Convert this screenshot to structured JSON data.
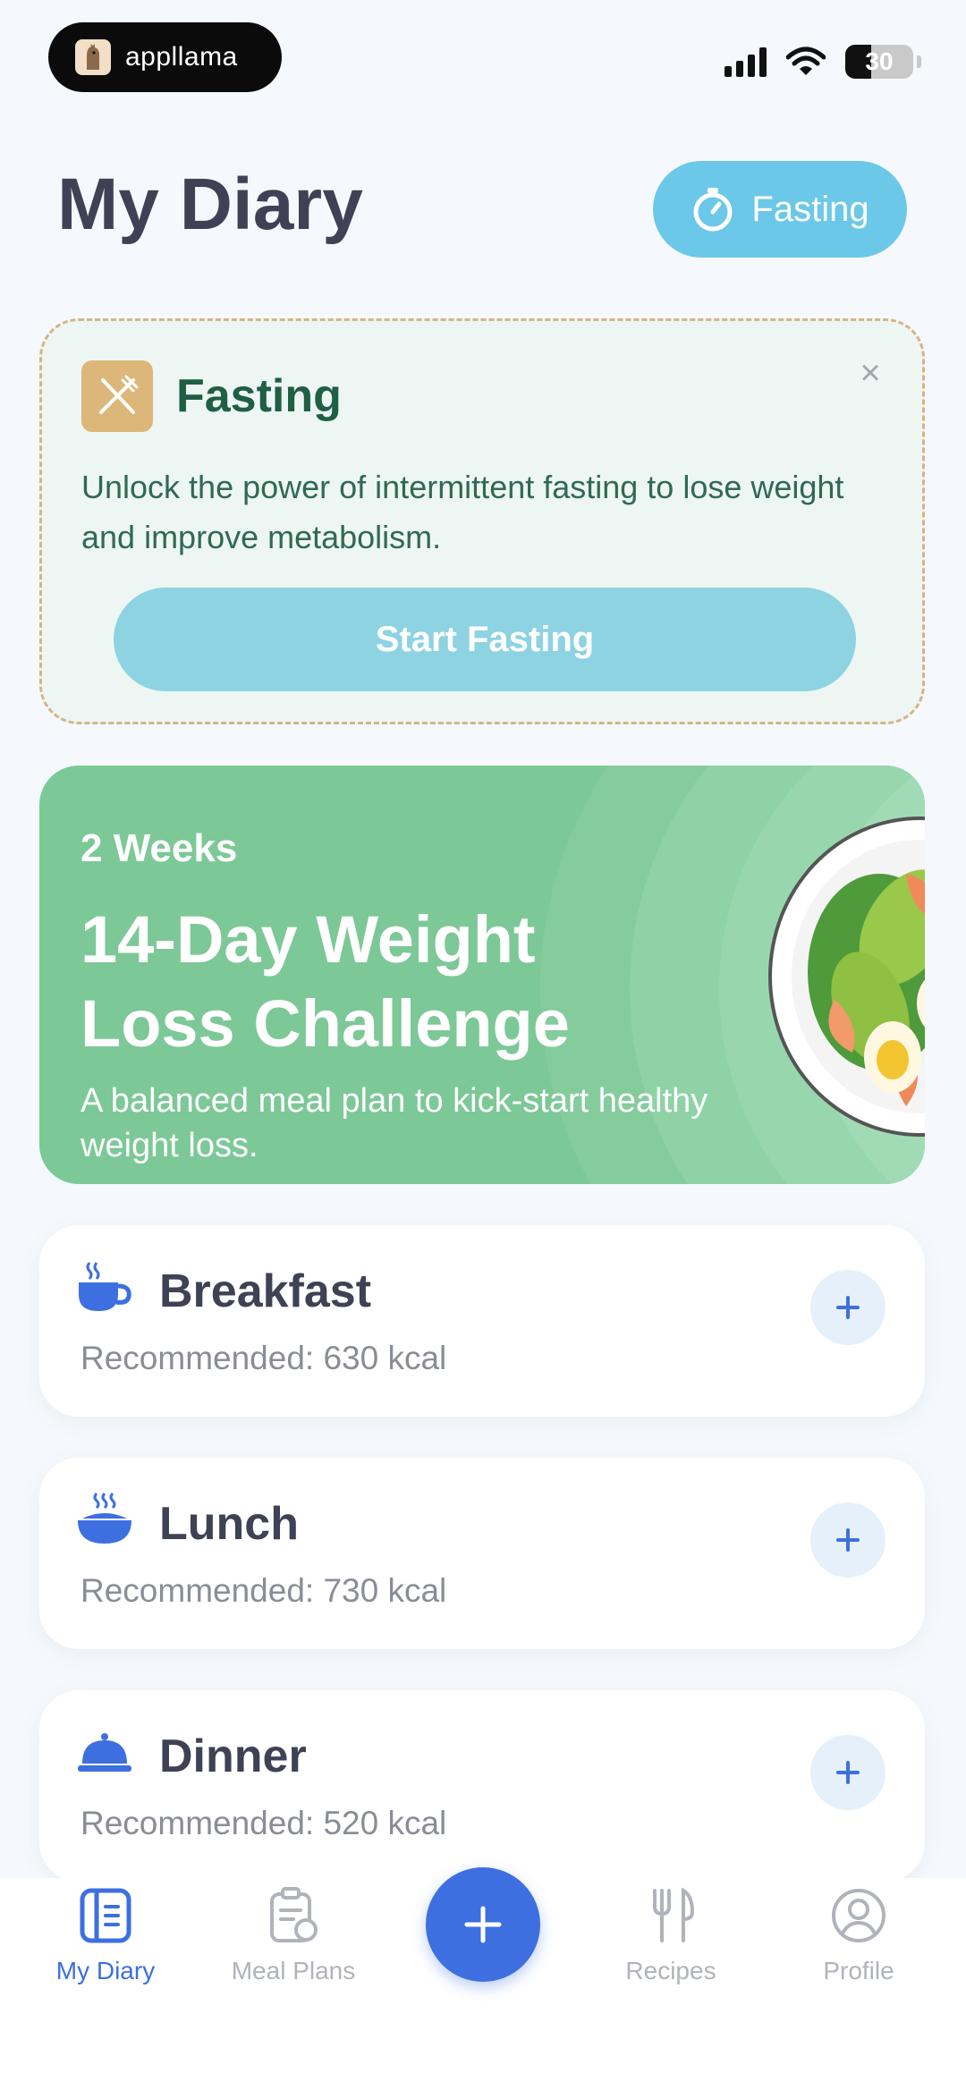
{
  "status_bar": {
    "brand": "appllama",
    "battery": "30"
  },
  "header": {
    "title": "My Diary",
    "fasting_button": "Fasting"
  },
  "fasting_card": {
    "title": "Fasting",
    "description": "Unlock the power of intermittent fasting to lose weight and improve metabolism.",
    "button": "Start Fasting",
    "close": "×"
  },
  "challenge": {
    "duration": "2 Weeks",
    "title": "14-Day Weight Loss Challenge",
    "description": "A balanced meal plan to kick-start healthy weight loss."
  },
  "meals": [
    {
      "name": "Breakfast",
      "recommended": "Recommended: 630 kcal",
      "icon": "coffee-cup-icon"
    },
    {
      "name": "Lunch",
      "recommended": "Recommended: 730 kcal",
      "icon": "bowl-icon"
    },
    {
      "name": "Dinner",
      "recommended": "Recommended: 520 kcal",
      "icon": "cloche-icon"
    }
  ],
  "nav": {
    "items": [
      {
        "label": "My Diary",
        "icon": "diary-icon",
        "active": true
      },
      {
        "label": "Meal Plans",
        "icon": "clipboard-icon",
        "active": false
      },
      {
        "label": "Recipes",
        "icon": "fork-knife-icon",
        "active": false
      },
      {
        "label": "Profile",
        "icon": "profile-icon",
        "active": false
      }
    ],
    "add": "+"
  },
  "colors": {
    "accent": "#3d6fe0",
    "fasting_blue": "#6bc8e8",
    "challenge_green": "#7dc897",
    "fasting_title": "#1f5f43"
  }
}
